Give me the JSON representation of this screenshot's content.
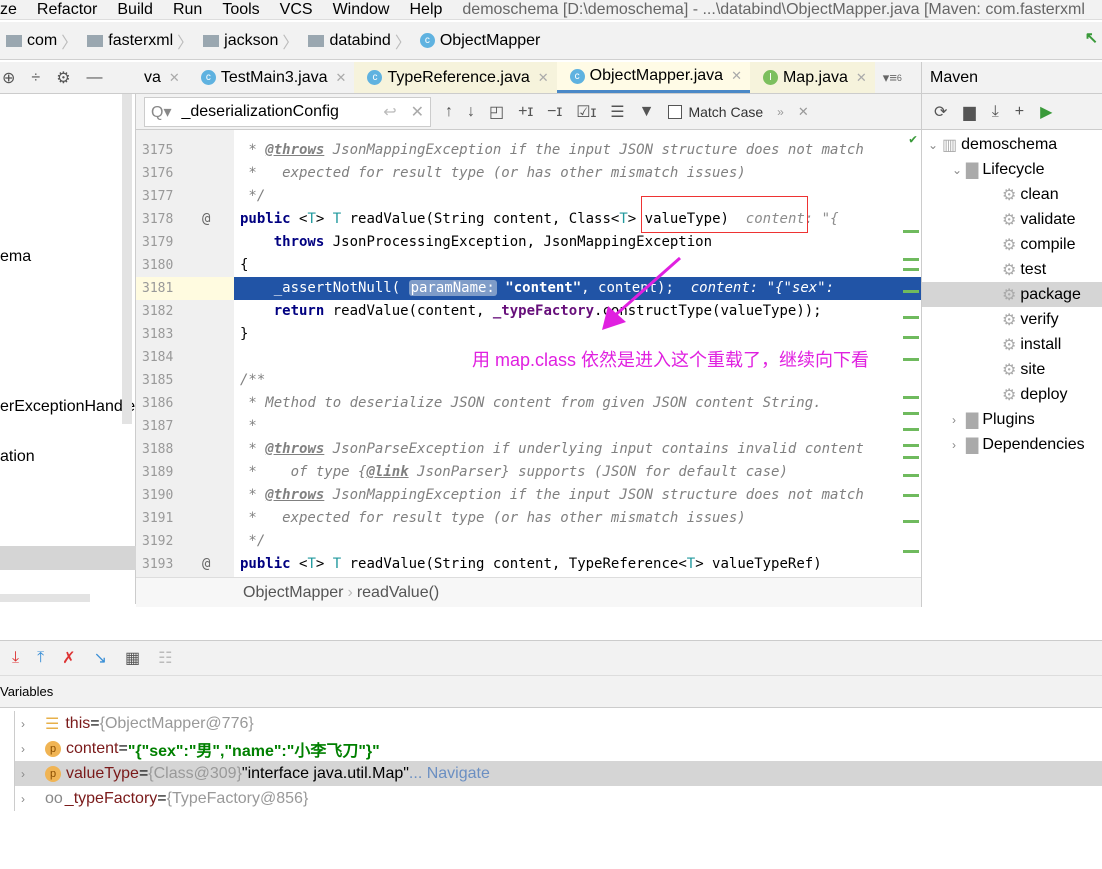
{
  "menubar": {
    "items": [
      "ze",
      "Refactor",
      "Build",
      "Run",
      "Tools",
      "VCS",
      "Window",
      "Help"
    ],
    "title": "demoschema [D:\\demoschema] - ...\\databind\\ObjectMapper.java [Maven: com.fasterxml"
  },
  "breadcrumb": [
    "com",
    "fasterxml",
    "jackson",
    "databind",
    "ObjectMapper"
  ],
  "tabs": [
    {
      "label": "va",
      "style": "plain"
    },
    {
      "label": "TestMain3.java",
      "style": "plain"
    },
    {
      "label": "TypeReference.java",
      "style": "yellow"
    },
    {
      "label": "ObjectMapper.java",
      "style": "active"
    },
    {
      "label": "Map.java",
      "style": "yellow"
    }
  ],
  "tabs_overflow": "6",
  "search": {
    "value": "_deserializationConfig",
    "match_case_label": "Match Case",
    "match_case_checked": false
  },
  "left_panel": {
    "items": [
      "ema",
      "erExceptionHandle",
      "ation"
    ]
  },
  "code_lines": [
    {
      "n": "3175",
      "seg": [
        [
          "c-com",
          " * "
        ],
        [
          "c-tag",
          "@throws"
        ],
        [
          "c-com",
          " JsonMappingException if the input JSON structure does not match"
        ]
      ]
    },
    {
      "n": "3176",
      "seg": [
        [
          "c-com",
          " *   expected for result type (or has other mismatch issues)"
        ]
      ]
    },
    {
      "n": "3177",
      "seg": [
        [
          "c-com",
          " */"
        ]
      ]
    },
    {
      "n": "3178",
      "mark": "@",
      "seg": [
        [
          "c-kw",
          "public "
        ],
        [
          "c-plain",
          "<"
        ],
        [
          "c-tp",
          "T"
        ],
        [
          "c-plain",
          "> "
        ],
        [
          "c-tp",
          "T"
        ],
        [
          "c-plain",
          " readValue(String content, Class<"
        ],
        [
          "c-tp",
          "T"
        ],
        [
          "c-plain",
          "> valueType)  "
        ],
        [
          "c-hint",
          "content: \"{"
        ]
      ]
    },
    {
      "n": "3179",
      "seg": [
        [
          "c-plain",
          "    "
        ],
        [
          "c-kw",
          "throws"
        ],
        [
          "c-plain",
          " JsonProcessingException, JsonMappingException"
        ]
      ]
    },
    {
      "n": "3180",
      "seg": [
        [
          "c-plain",
          "{"
        ]
      ]
    },
    {
      "n": "3181",
      "hl": true,
      "seg": [
        [
          "c-plain",
          "    _assertNotNull( "
        ],
        [
          "c-pn",
          "paramName:"
        ],
        [
          "c-str",
          " \"content\""
        ],
        [
          "c-plain",
          ", content);  "
        ],
        [
          "c-hint",
          "content: \"{\"sex\":"
        ]
      ]
    },
    {
      "n": "3182",
      "seg": [
        [
          "c-plain",
          "    "
        ],
        [
          "c-kw",
          "return"
        ],
        [
          "c-plain",
          " readValue(content, "
        ],
        [
          "c-fld",
          "_typeFactory"
        ],
        [
          "c-plain",
          ".constructType(valueType));"
        ]
      ]
    },
    {
      "n": "3183",
      "seg": [
        [
          "c-plain",
          "}"
        ]
      ]
    },
    {
      "n": "3184",
      "seg": []
    },
    {
      "n": "3185",
      "seg": [
        [
          "c-com",
          "/**"
        ]
      ]
    },
    {
      "n": "3186",
      "seg": [
        [
          "c-com",
          " * Method to deserialize JSON content from given JSON content String."
        ]
      ]
    },
    {
      "n": "3187",
      "seg": [
        [
          "c-com",
          " *"
        ]
      ]
    },
    {
      "n": "3188",
      "seg": [
        [
          "c-com",
          " * "
        ],
        [
          "c-tag",
          "@throws"
        ],
        [
          "c-com",
          " JsonParseException if underlying input contains invalid content"
        ]
      ]
    },
    {
      "n": "3189",
      "seg": [
        [
          "c-com",
          " *    of type {"
        ],
        [
          "c-tag",
          "@link"
        ],
        [
          "c-com",
          " JsonParser} supports (JSON for default case)"
        ]
      ]
    },
    {
      "n": "3190",
      "seg": [
        [
          "c-com",
          " * "
        ],
        [
          "c-tag",
          "@throws"
        ],
        [
          "c-com",
          " JsonMappingException if the input JSON structure does not match"
        ]
      ]
    },
    {
      "n": "3191",
      "seg": [
        [
          "c-com",
          " *   expected for result type (or has other mismatch issues)"
        ]
      ]
    },
    {
      "n": "3192",
      "seg": [
        [
          "c-com",
          " */"
        ]
      ]
    },
    {
      "n": "3193",
      "mark": "@",
      "seg": [
        [
          "c-kw",
          "public "
        ],
        [
          "c-plain",
          "<"
        ],
        [
          "c-tp",
          "T"
        ],
        [
          "c-plain",
          "> "
        ],
        [
          "c-tp",
          "T"
        ],
        [
          "c-plain",
          " readValue(String content, TypeReference<"
        ],
        [
          "c-tp",
          "T"
        ],
        [
          "c-plain",
          "> valueTypeRef)"
        ]
      ]
    }
  ],
  "editor_breadcrumb": [
    "ObjectMapper",
    "readValue()"
  ],
  "annotation": {
    "text": "用 map.class 依然是进入这个重载了，继续向下看",
    "color": "#e020e0"
  },
  "maven": {
    "title": "Maven",
    "project": "demoschema",
    "lifecycle": "Lifecycle",
    "goals": [
      "clean",
      "validate",
      "compile",
      "test",
      "package",
      "verify",
      "install",
      "site",
      "deploy"
    ],
    "selected_goal": "package",
    "plugins": "Plugins",
    "dependencies": "Dependencies"
  },
  "debugger": {
    "variables_label": "Variables",
    "vars": [
      {
        "icon": "field-list",
        "name": "this",
        "eq": " = ",
        "ref": "{ObjectMapper@776}",
        "value": "",
        "nav": ""
      },
      {
        "icon": "p",
        "name": "content",
        "eq": " = ",
        "ref": "",
        "value": "\"{\"sex\":\"男\",\"name\":\"小李飞刀\"}\"",
        "nav": ""
      },
      {
        "icon": "p",
        "name": "valueType",
        "eq": " = ",
        "ref": "{Class@309}",
        "value": " \"interface java.util.Map\"",
        "nav": "... Navigate",
        "selected": true
      },
      {
        "icon": "oo",
        "name": "_typeFactory",
        "eq": " = ",
        "ref": "{TypeFactory@856}",
        "value": "",
        "nav": ""
      }
    ]
  },
  "colors": {
    "accent": "#4a88c7",
    "highlight_line": "#2154a6",
    "annotation": "#e020e0",
    "box": "#e33333"
  }
}
